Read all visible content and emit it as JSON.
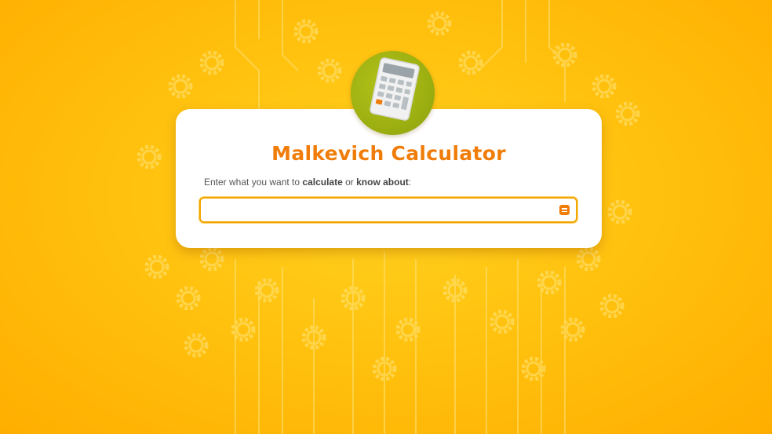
{
  "app": {
    "title": "Malkevich Calculator"
  },
  "instruction": {
    "prefix": "Enter what you want to ",
    "keyword1": "calculate",
    "middle": " or ",
    "keyword2": "know about",
    "suffix": ":"
  },
  "search": {
    "value": "",
    "placeholder": "",
    "menu_icon": "menu-icon"
  },
  "logo": {
    "icon": "calculator-icon"
  },
  "colors": {
    "accent": "#f07d0a",
    "background": "#ffc20f",
    "logo_circle": "#9cb011"
  }
}
